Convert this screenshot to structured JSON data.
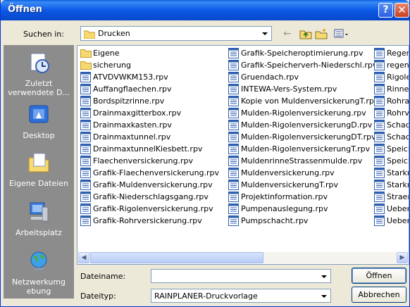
{
  "window": {
    "title": "Öffnen",
    "help_label": "?",
    "close_label": "✕"
  },
  "lookin": {
    "label": "Suchen in:",
    "value": "Drucken"
  },
  "places": [
    {
      "id": "recent",
      "label": "Zuletzt verwendete D...",
      "icon": "recent-documents-icon"
    },
    {
      "id": "desktop",
      "label": "Desktop",
      "icon": "desktop-icon"
    },
    {
      "id": "mydocs",
      "label": "Eigene Dateien",
      "icon": "my-documents-icon"
    },
    {
      "id": "mycomputer",
      "label": "Arbeitsplatz",
      "icon": "my-computer-icon"
    },
    {
      "id": "network",
      "label": "Netzwerkumgebung",
      "icon": "network-places-icon"
    }
  ],
  "files": {
    "column1": [
      {
        "name": "Eigene",
        "type": "folder"
      },
      {
        "name": "sicherung",
        "type": "folder"
      },
      {
        "name": "ATVDVWKM153.rpv",
        "type": "file"
      },
      {
        "name": "Auffangflaechen.rpv",
        "type": "file"
      },
      {
        "name": "Bordspitzrinne.rpv",
        "type": "file"
      },
      {
        "name": "Drainmaxgitterbox.rpv",
        "type": "file"
      },
      {
        "name": "Drainmaxkasten.rpv",
        "type": "file"
      },
      {
        "name": "Drainmaxtunnel.rpv",
        "type": "file"
      },
      {
        "name": "DrainmaxtunnelKiesbett.rpv",
        "type": "file"
      },
      {
        "name": "Flaechenversickerung.rpv",
        "type": "file"
      },
      {
        "name": "Grafik-Flaechenversickerung.rpv",
        "type": "file"
      },
      {
        "name": "Grafik-Muldenversickerung.rpv",
        "type": "file"
      },
      {
        "name": "Grafik-Niederschlagsgang.rpv",
        "type": "file"
      },
      {
        "name": "Grafik-Rigolenversickerung.rpv",
        "type": "file"
      },
      {
        "name": "Grafik-Rohrversickerung.rpv",
        "type": "file"
      }
    ],
    "column2": [
      {
        "name": "Grafik-Speicheroptimierung.rpv",
        "type": "file"
      },
      {
        "name": "Grafik-Speicherverh-Niederschl.rpv",
        "type": "file"
      },
      {
        "name": "Gruendach.rpv",
        "type": "file"
      },
      {
        "name": "INTEWA-Vers-System.rpv",
        "type": "file"
      },
      {
        "name": "Kopie von MuldenversickerungT.rpv",
        "type": "file"
      },
      {
        "name": "Mulden-Rigolenversickerung.rpv",
        "type": "file"
      },
      {
        "name": "Mulden-RigolenversickerungD.rpv",
        "type": "file"
      },
      {
        "name": "Mulden-RigolenversickerungDT.rpv",
        "type": "file"
      },
      {
        "name": "Mulden-RigolenversickerungT.rpv",
        "type": "file"
      },
      {
        "name": "MuldenrinneStrassenmulde.rpv",
        "type": "file"
      },
      {
        "name": "Muldenversickerung.rpv",
        "type": "file"
      },
      {
        "name": "MuldenversickerungT.rpv",
        "type": "file"
      },
      {
        "name": "Projektinformation.rpv",
        "type": "file"
      },
      {
        "name": "Pumpenauslegung.rpv",
        "type": "file"
      },
      {
        "name": "Pumpschacht.rpv",
        "type": "file"
      }
    ],
    "column3": [
      {
        "name": "Regen",
        "type": "file"
      },
      {
        "name": "regenr",
        "type": "file"
      },
      {
        "name": "Rigoler",
        "type": "file"
      },
      {
        "name": "Rinner",
        "type": "file"
      },
      {
        "name": "Rohral",
        "type": "file"
      },
      {
        "name": "Rohrv",
        "type": "file"
      },
      {
        "name": "Schact",
        "type": "file"
      },
      {
        "name": "Schact",
        "type": "file"
      },
      {
        "name": "Speich",
        "type": "file"
      },
      {
        "name": "Speich",
        "type": "file"
      },
      {
        "name": "Starkn",
        "type": "file"
      },
      {
        "name": "Starkn",
        "type": "file"
      },
      {
        "name": "Straer",
        "type": "file"
      },
      {
        "name": "Ueberl",
        "type": "file"
      },
      {
        "name": "Ueberl",
        "type": "file"
      }
    ]
  },
  "scrollbar": {
    "left_arrow": "◀",
    "right_arrow": "▶"
  },
  "filename": {
    "label": "Dateiname:",
    "value": ""
  },
  "filetype": {
    "label": "Dateityp:",
    "value": "RAINPLANER-Druckvorlage"
  },
  "buttons": {
    "open": "Öffnen",
    "cancel": "Abbrechen"
  },
  "toolbar": {
    "back": "←"
  },
  "colors": {
    "titlebar": "#0a5fe0",
    "places_bar": "#8c8c8c",
    "dialog_bg": "#ece9d8",
    "selection_blue": "#316ac5"
  }
}
